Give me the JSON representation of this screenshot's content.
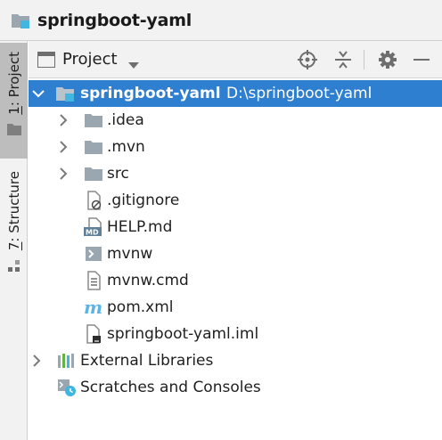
{
  "breadcrumb": {
    "project_name": "springboot-yaml",
    "icon": "project-folder-icon"
  },
  "tool_stripe": {
    "tabs": [
      {
        "number": "1",
        "label": ": Project",
        "icon": "folder-icon",
        "active": true
      },
      {
        "number": "7",
        "label": ": Structure",
        "icon": "structure-icon",
        "active": false
      }
    ]
  },
  "panel": {
    "view_mode": "Project",
    "actions": [
      {
        "name": "locate",
        "icon": "crosshair-icon"
      },
      {
        "name": "collapse-all",
        "icon": "collapse-icon"
      },
      {
        "name": "settings",
        "icon": "gear-icon"
      },
      {
        "name": "hide",
        "icon": "minimize-icon"
      }
    ]
  },
  "tree": {
    "root": {
      "name": "springboot-yaml",
      "path": "D:\\springboot-yaml",
      "icon": "module-folder-icon",
      "expanded": true,
      "selected": true
    },
    "children": [
      {
        "name": ".idea",
        "icon": "folder-icon",
        "expandable": true
      },
      {
        "name": ".mvn",
        "icon": "folder-icon",
        "expandable": true
      },
      {
        "name": "src",
        "icon": "folder-icon",
        "expandable": true
      },
      {
        "name": ".gitignore",
        "icon": "ignore-file-icon",
        "expandable": false
      },
      {
        "name": "HELP.md",
        "icon": "markdown-file-icon",
        "expandable": false
      },
      {
        "name": "mvnw",
        "icon": "shell-script-icon",
        "expandable": false
      },
      {
        "name": "mvnw.cmd",
        "icon": "text-file-icon",
        "expandable": false
      },
      {
        "name": "pom.xml",
        "icon": "maven-icon",
        "expandable": false
      },
      {
        "name": "springboot-yaml.iml",
        "icon": "iml-file-icon",
        "expandable": false
      }
    ],
    "external_libraries": {
      "name": "External Libraries",
      "icon": "library-icon",
      "expandable": true
    },
    "scratches": {
      "name": "Scratches and Consoles",
      "icon": "scratches-icon",
      "expandable": false
    }
  },
  "colors": {
    "selection": "#2f7fd0",
    "folder": "#9aa7b0",
    "module_folder_accent": "#40b6e0",
    "maven": "#5ab4e8"
  }
}
